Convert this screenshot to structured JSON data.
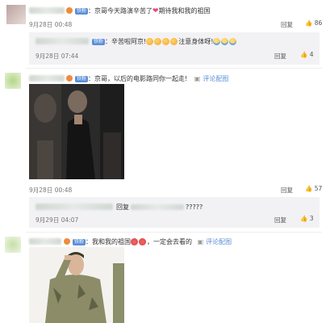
{
  "comments": [
    {
      "text": "：京哥今天路演辛苦了",
      "text2": "期待我和我的祖国",
      "time": "9月28日 00:48",
      "reply_label": "回复",
      "like_count": "86",
      "badge": "铁粉",
      "nested": {
        "badge": "铁粉",
        "text": "：辛苦啦阿京!",
        "text2": "注意身体呀!",
        "time": "9月28日 07:44",
        "reply_label": "回复",
        "like_count": "4"
      }
    },
    {
      "badge": "铁粉",
      "text": "：京哥，以后的电影路同你一起走!",
      "pic_label": "评论配图",
      "time": "9月28日 00:48",
      "reply_label": "回复",
      "like_count": "57",
      "nested": {
        "text": "回复",
        "text2": "?????",
        "time": "9月29日 04:07",
        "reply_label": "回复",
        "like_count": "3"
      }
    },
    {
      "badge": "铁粉",
      "text": "：我和我的祖国",
      "text2": "，一定会去看的",
      "pic_label": "评论配图"
    }
  ],
  "colors": {
    "link": "#eb7350",
    "badge": "#5b8fd8",
    "reply_bg": "#f2f2f5"
  }
}
